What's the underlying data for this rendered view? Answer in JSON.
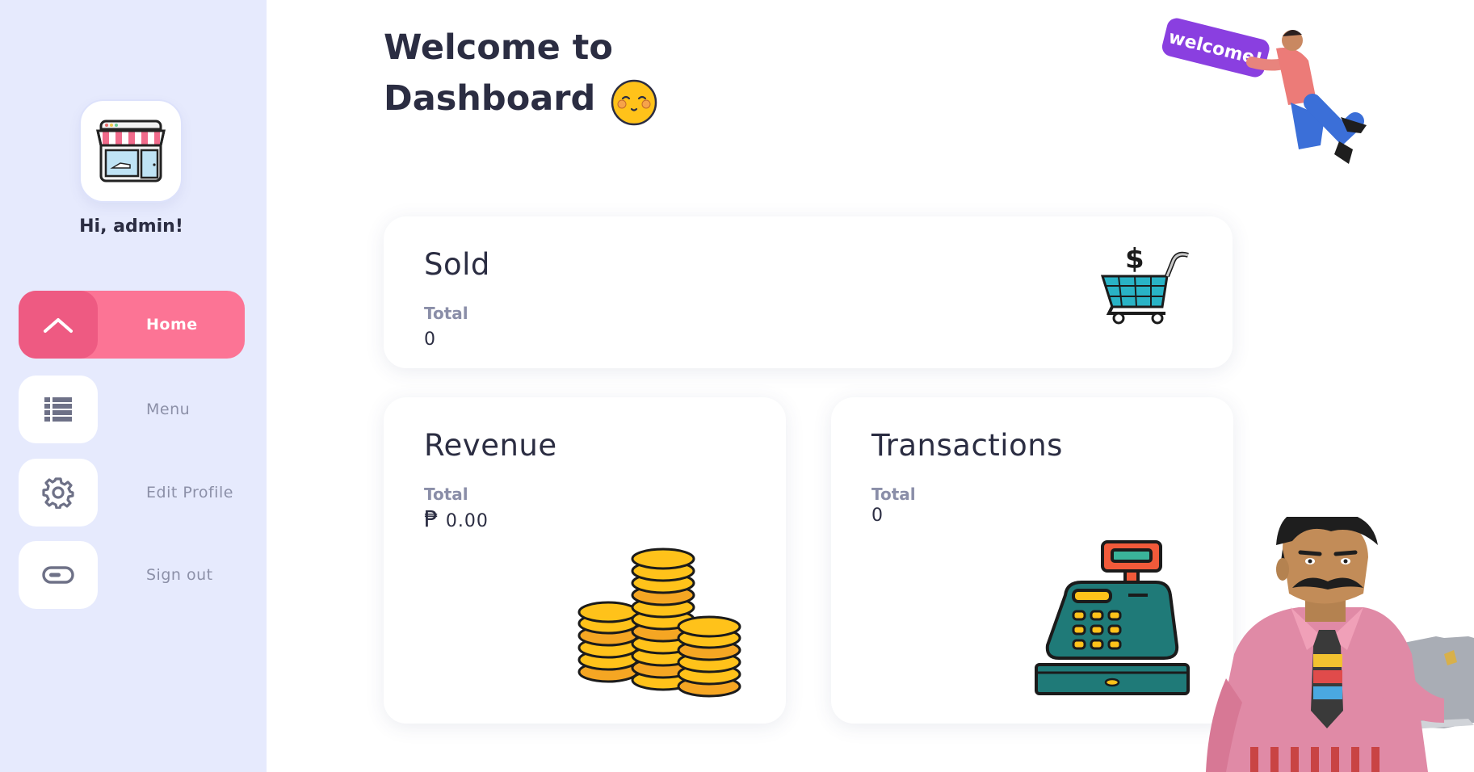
{
  "sidebar": {
    "greeting": "Hi, admin!",
    "items": [
      {
        "label": "Home",
        "icon": "home-icon",
        "active": true
      },
      {
        "label": "Menu",
        "icon": "list-icon",
        "active": false
      },
      {
        "label": "Edit Profile",
        "icon": "gear-icon",
        "active": false
      },
      {
        "label": "Sign out",
        "icon": "toggle-icon",
        "active": false
      }
    ]
  },
  "header": {
    "title_line1": "Welcome to",
    "title_line2": "Dashboard",
    "banner_text": "welcome!"
  },
  "cards": {
    "sold": {
      "title": "Sold",
      "sub": "Total",
      "value": "0",
      "icon": "shopping-cart-icon"
    },
    "revenue": {
      "title": "Revenue",
      "sub": "Total",
      "currency": "₱",
      "value": "0.00",
      "icon": "coins-icon"
    },
    "transactions": {
      "title": "Transactions",
      "sub": "Total",
      "value": "0",
      "icon": "cash-register-icon"
    }
  },
  "colors": {
    "sidebar_bg": "#e6eafd",
    "accent": "#fc7495",
    "accent_dark": "#ee5a82",
    "text": "#2b2d42",
    "muted": "#8c90a8"
  }
}
